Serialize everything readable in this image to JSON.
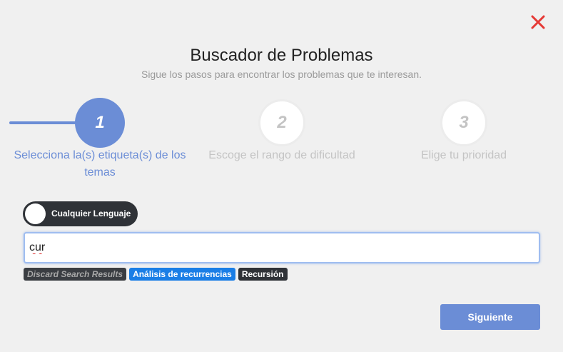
{
  "header": {
    "title": "Buscador de Problemas",
    "subtitle": "Sigue los pasos para encontrar los problemas que te interesan.",
    "close_icon": "close-icon",
    "close_color": "#e53935"
  },
  "steps": [
    {
      "number": "1",
      "label": "Selecciona la(s) etiqueta(s) de los temas",
      "state": "active"
    },
    {
      "number": "2",
      "label": "Escoge el rango de dificultad",
      "state": "inactive"
    },
    {
      "number": "3",
      "label": "Elige tu prioridad",
      "state": "inactive"
    }
  ],
  "language_toggle": {
    "label": "Cualquier Lenguaje",
    "on": false
  },
  "search": {
    "value": "cur"
  },
  "tags": [
    {
      "label": "Discard Search Results",
      "style": "discard"
    },
    {
      "label": "Análisis de recurrencias",
      "style": "blue"
    },
    {
      "label": "Recursión",
      "style": "dark"
    }
  ],
  "footer": {
    "next_label": "Siguiente"
  },
  "colors": {
    "accent": "#6b8dd6",
    "tag_blue": "#1a7ee6",
    "dark": "#2f3237",
    "muted": "#c4c4c4"
  }
}
